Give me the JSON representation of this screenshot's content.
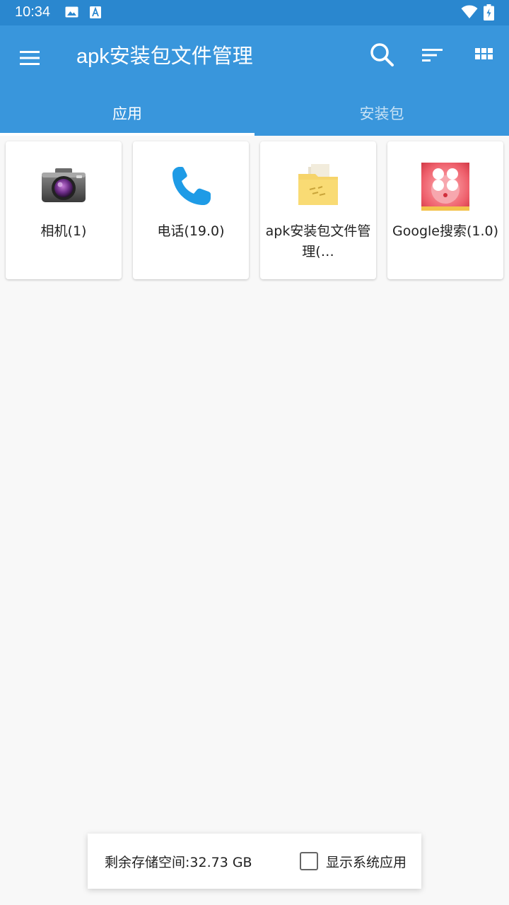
{
  "status_bar": {
    "time": "10:34",
    "icons": [
      "image-icon",
      "font-a-icon",
      "wifi-icon",
      "battery-charging-icon"
    ]
  },
  "app_bar": {
    "title": "apk安装包文件管理",
    "color": "#3996dc",
    "actions": [
      "menu-icon",
      "search-icon",
      "sort-icon",
      "grid-view-icon"
    ]
  },
  "tabs": [
    {
      "label": "应用",
      "selected": true
    },
    {
      "label": "安装包",
      "selected": false
    }
  ],
  "apps": [
    {
      "label": "相机(1)",
      "icon": "camera-icon"
    },
    {
      "label": "电话(19.0)",
      "icon": "phone-icon"
    },
    {
      "label": "apk安装包文件管理(…",
      "icon": "folder-icon"
    },
    {
      "label": "Google搜索(1.0)",
      "icon": "google-search-icon"
    }
  ],
  "footer": {
    "storage": "剩余存储空间:32.73 GB",
    "show_system_apps_label": "显示系统应用",
    "show_system_apps_checked": false
  }
}
